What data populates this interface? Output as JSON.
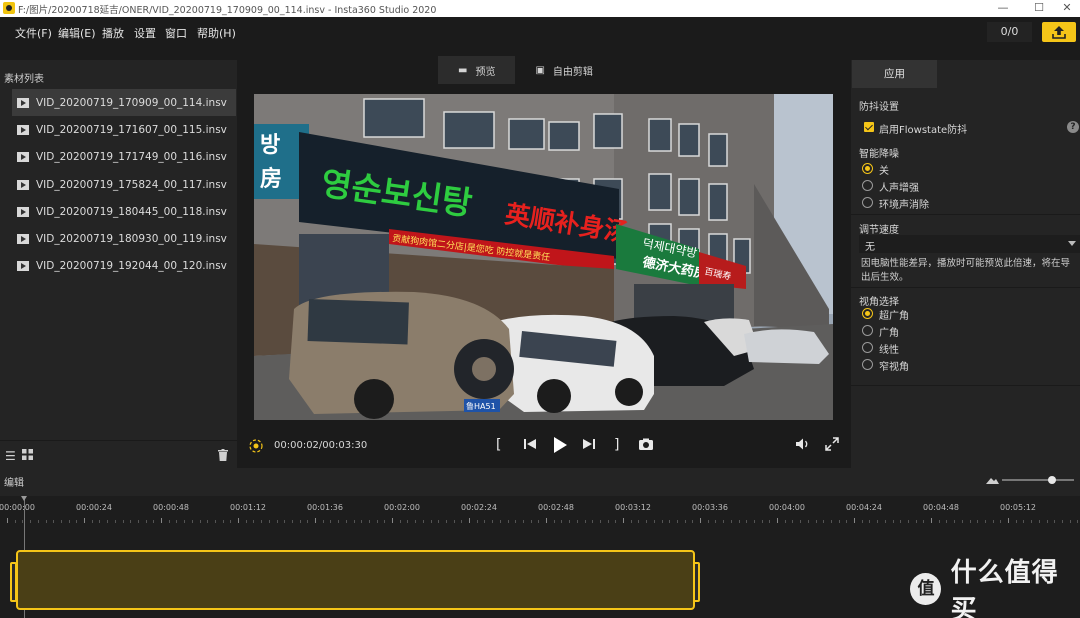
{
  "window": {
    "title": "F:/图片/20200718延吉/ONER/VID_20200719_170909_00_114.insv - Insta360 Studio 2020",
    "minimize": "—",
    "maximize": "☐",
    "close": "✕"
  },
  "menu": {
    "items": [
      "文件(F)",
      "编辑(E)",
      "播放",
      "设置",
      "窗口",
      "帮助(H)"
    ],
    "counter": "0/0"
  },
  "library": {
    "title": "素材列表",
    "files": [
      "VID_20200719_170909_00_114.insv",
      "VID_20200719_171607_00_115.insv",
      "VID_20200719_171749_00_116.insv",
      "VID_20200719_175824_00_117.insv",
      "VID_20200719_180445_00_118.insv",
      "VID_20200719_180930_00_119.insv",
      "VID_20200719_192044_00_120.insv"
    ],
    "selected_index": 0
  },
  "preview": {
    "tabs": [
      {
        "label": "预览",
        "icon": "flag-icon"
      },
      {
        "label": "自由剪辑",
        "icon": "camera-frame-icon"
      }
    ],
    "active_tab": 0,
    "signs": {
      "blue": "방\n房",
      "shop_korean": "영순보신탕",
      "shop_chinese": "英顺补身汤",
      "shop_small": "贡献狗肉馆二分店|是您吃 防控就是责任",
      "pharmacy_korean": "덕제대약방",
      "pharmacy_chinese": "德济大药房",
      "shop_right": "百瑞寿",
      "plate": "鲁HA51"
    },
    "timecode": "00:00:02/00:03:30"
  },
  "settings": {
    "apply_tab": "应用",
    "stabilization": {
      "title": "防抖设置",
      "flowstate_label": "启用Flowstate防抖",
      "flowstate_checked": true,
      "help": "?"
    },
    "denoise": {
      "title": "智能降噪",
      "options": [
        "关",
        "人声增强",
        "环境声消除"
      ],
      "selected": 0
    },
    "speed": {
      "title": "调节速度",
      "value": "无",
      "note": "因电脑性能差异，播放时可能预览此倍速，将在导出后生效。"
    },
    "view": {
      "title": "视角选择",
      "options": [
        "超广角",
        "广角",
        "线性",
        "窄视角"
      ],
      "selected": 0
    }
  },
  "timeline": {
    "title": "编辑",
    "zoom_level": 0.7,
    "ticks": [
      "00:00:00",
      "00:00:24",
      "00:00:48",
      "00:01:12",
      "00:01:36",
      "00:02:00",
      "00:02:24",
      "00:02:48",
      "00:03:12",
      "00:03:36",
      "00:04:00",
      "00:04:24",
      "00:04:48",
      "00:05:12"
    ]
  },
  "watermark": {
    "text": "什么值得买"
  },
  "colors": {
    "accent": "#f5c518",
    "background": "#1b1b1b",
    "panel": "#242424"
  }
}
